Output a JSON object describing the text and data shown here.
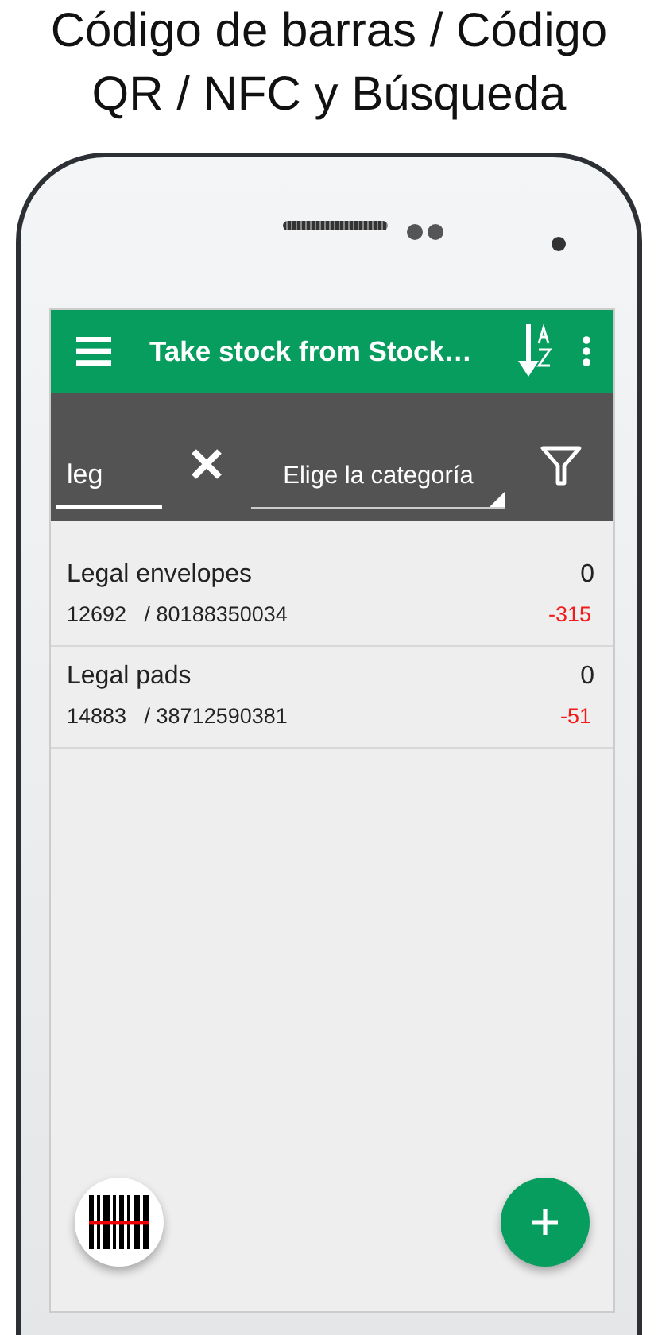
{
  "headline": [
    "Código de barras / Código",
    "QR / NFC y Búsqueda"
  ],
  "toolbar": {
    "title": "Take stock from Stock…"
  },
  "search": {
    "value": "leg"
  },
  "category": {
    "label": "Elige la categoría"
  },
  "items": [
    {
      "name": "Legal envelopes",
      "quantity": "0",
      "code": "12692",
      "barcode": "/ 80188350034",
      "difference": "-315"
    },
    {
      "name": "Legal pads",
      "quantity": "0",
      "code": "14883",
      "barcode": "/ 38712590381",
      "difference": "-51"
    }
  ]
}
